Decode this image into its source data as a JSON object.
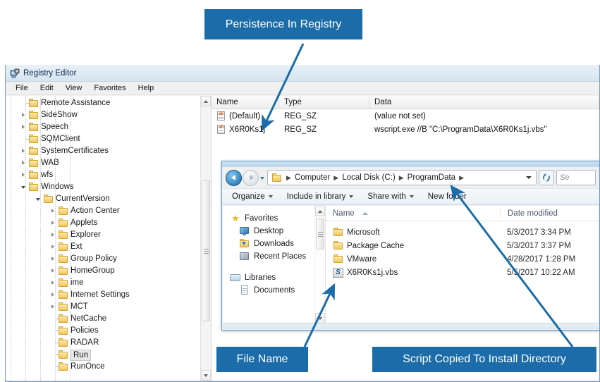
{
  "regedit": {
    "title": "Registry Editor",
    "icon": "registry-editor-icon",
    "menu": [
      "File",
      "Edit",
      "View",
      "Favorites",
      "Help"
    ],
    "tree": [
      {
        "label": "Remote Assistance",
        "depth": 4,
        "state": "leaf"
      },
      {
        "label": "SideShow",
        "depth": 4,
        "state": "collapsed"
      },
      {
        "label": "Speech",
        "depth": 4,
        "state": "collapsed"
      },
      {
        "label": "SQMClient",
        "depth": 4,
        "state": "leaf"
      },
      {
        "label": "SystemCertificates",
        "depth": 4,
        "state": "collapsed"
      },
      {
        "label": "WAB",
        "depth": 4,
        "state": "collapsed"
      },
      {
        "label": "wfs",
        "depth": 4,
        "state": "collapsed"
      },
      {
        "label": "Windows",
        "depth": 4,
        "state": "expanded"
      },
      {
        "label": "CurrentVersion",
        "depth": 5,
        "state": "expanded"
      },
      {
        "label": "Action Center",
        "depth": 6,
        "state": "collapsed"
      },
      {
        "label": "Applets",
        "depth": 6,
        "state": "collapsed"
      },
      {
        "label": "Explorer",
        "depth": 6,
        "state": "collapsed"
      },
      {
        "label": "Ext",
        "depth": 6,
        "state": "collapsed"
      },
      {
        "label": "Group Policy",
        "depth": 6,
        "state": "collapsed"
      },
      {
        "label": "HomeGroup",
        "depth": 6,
        "state": "collapsed"
      },
      {
        "label": "ime",
        "depth": 6,
        "state": "collapsed"
      },
      {
        "label": "Internet Settings",
        "depth": 6,
        "state": "collapsed"
      },
      {
        "label": "MCT",
        "depth": 6,
        "state": "collapsed"
      },
      {
        "label": "NetCache",
        "depth": 6,
        "state": "leaf"
      },
      {
        "label": "Policies",
        "depth": 6,
        "state": "leaf"
      },
      {
        "label": "RADAR",
        "depth": 6,
        "state": "leaf"
      },
      {
        "label": "Run",
        "depth": 6,
        "state": "leaf",
        "selected": true
      },
      {
        "label": "RunOnce",
        "depth": 6,
        "state": "leaf"
      }
    ],
    "values": {
      "columns": [
        "Name",
        "Type",
        "Data"
      ],
      "rows": [
        {
          "name": "(Default)",
          "type": "REG_SZ",
          "data": "(value not set)",
          "icon": "ab-string-icon"
        },
        {
          "name": "X6R0Ks1j",
          "type": "REG_SZ",
          "data": "wscript.exe //B \"C:\\ProgramData\\X6R0Ks1j.vbs\"",
          "icon": "ab-string-icon"
        }
      ]
    }
  },
  "explorer": {
    "breadcrumb": [
      "Computer",
      "Local Disk (C:)",
      "ProgramData"
    ],
    "search_placeholder": "Se",
    "toolbar": [
      {
        "label": "Organize",
        "caret": true
      },
      {
        "label": "Include in library",
        "caret": true
      },
      {
        "label": "Share with",
        "caret": true
      },
      {
        "label": "New folder",
        "caret": false
      }
    ],
    "navpane": [
      {
        "label": "Favorites",
        "icon": "star-icon",
        "level": 0
      },
      {
        "label": "Desktop",
        "icon": "desktop-icon",
        "level": 1
      },
      {
        "label": "Downloads",
        "icon": "downloads-icon",
        "level": 1
      },
      {
        "label": "Recent Places",
        "icon": "recent-places-icon",
        "level": 1
      },
      {
        "label": "Libraries",
        "icon": "libraries-icon",
        "level": 0
      },
      {
        "label": "Documents",
        "icon": "documents-icon",
        "level": 1
      }
    ],
    "file_columns": [
      "Name",
      "Date modified"
    ],
    "files": [
      {
        "name": "Microsoft",
        "date": "5/3/2017 3:34 PM",
        "icon": "folder-icon"
      },
      {
        "name": "Package Cache",
        "date": "5/3/2017 3:37 PM",
        "icon": "folder-icon"
      },
      {
        "name": "VMware",
        "date": "4/28/2017 1:28 PM",
        "icon": "folder-icon"
      },
      {
        "name": "X6R0Ks1j.vbs",
        "date": "5/5/2017 10:22 AM",
        "icon": "vbs-script-icon"
      }
    ]
  },
  "annotations": {
    "color": "#1b6ca8",
    "items": [
      {
        "label": "Persistence In Registry",
        "id": "persistence-in-registry"
      },
      {
        "label": "File Name",
        "id": "file-name"
      },
      {
        "label": "Script Copied To Install Directory",
        "id": "script-copied-to-install-directory"
      }
    ]
  }
}
